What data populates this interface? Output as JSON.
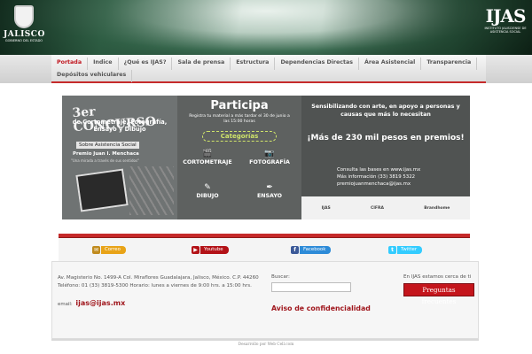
{
  "header": {
    "logo_left_name": "JALISCO",
    "logo_left_sub": "GOBIERNO DEL ESTADO",
    "logo_right_mark": "IJAS",
    "logo_right_sub": "INSTITUTO JALISCIENSE DE ASISTENCIA SOCIAL"
  },
  "nav": {
    "row1": [
      "Portada",
      "Indice",
      "¿Qué es IJAS?",
      "Sala de prensa",
      "Estructura",
      "Dependencias Directas",
      "Área Asistencial",
      "Transparencia"
    ],
    "row2": [
      "Depósitos vehiculares"
    ]
  },
  "banner": {
    "title_number": "3er CONCURSO",
    "title_categories": "de Cortometraje, Fotografía, Ensayo y Dibujo",
    "title_topic": "Sobre Asistencia Social",
    "title_award": "Premio Juan I. Menchaca",
    "title_tagline": "\"Una mirada a través de sus sentidos\"",
    "participa": "Participa",
    "registra": "Registra tu material a más tardar el 30 de junio a las 15:00 horas",
    "categorias_label": "Categorías",
    "categories": [
      "CORTOMETRAJE",
      "FOTOGRAFÍA",
      "DIBUJO",
      "ENSAYO"
    ],
    "sensibilizando": "Sensibilizando con arte, en apoyo a personas y causas que más lo necesitan",
    "premios": "¡Más de 230 mil pesos en premios!",
    "consulta_line1": "Consulta las bases en www.ijas.mx",
    "consulta_line2": "Más información (33) 3819 5322",
    "consulta_line3": "premiojuanmenchaca@ijas.mx",
    "sponsors": [
      "IJAS",
      "CIFRA",
      "Brandhome"
    ]
  },
  "social": {
    "correo": "Correo",
    "youtube": "Youtube",
    "facebook": "Facebook",
    "twitter": "Twitter"
  },
  "footer": {
    "address": "Av. Magisterio No. 1499-A Col. Miraflores Guadalajara, Jalisco, México. C.P. 44260",
    "phone": "Teléfono: 01 (33) 3819-5300 Horario: lunes a viernes de 9:00 hrs. a 15:00 hrs.",
    "email_label": "email:",
    "email_value": "ijas@ijas.mx",
    "search_label": "Buscar:",
    "search_value": "",
    "aviso": "Aviso de confidencialidad",
    "cerca": "En IJAS estamos cerca de ti",
    "preguntas": "Preguntas frecuentes",
    "credit": "Desarrollo por Web Cell.com"
  },
  "colors": {
    "accent_red": "#c62a2a",
    "link_red": "#a0171d",
    "header_green": "#2b5a40"
  }
}
